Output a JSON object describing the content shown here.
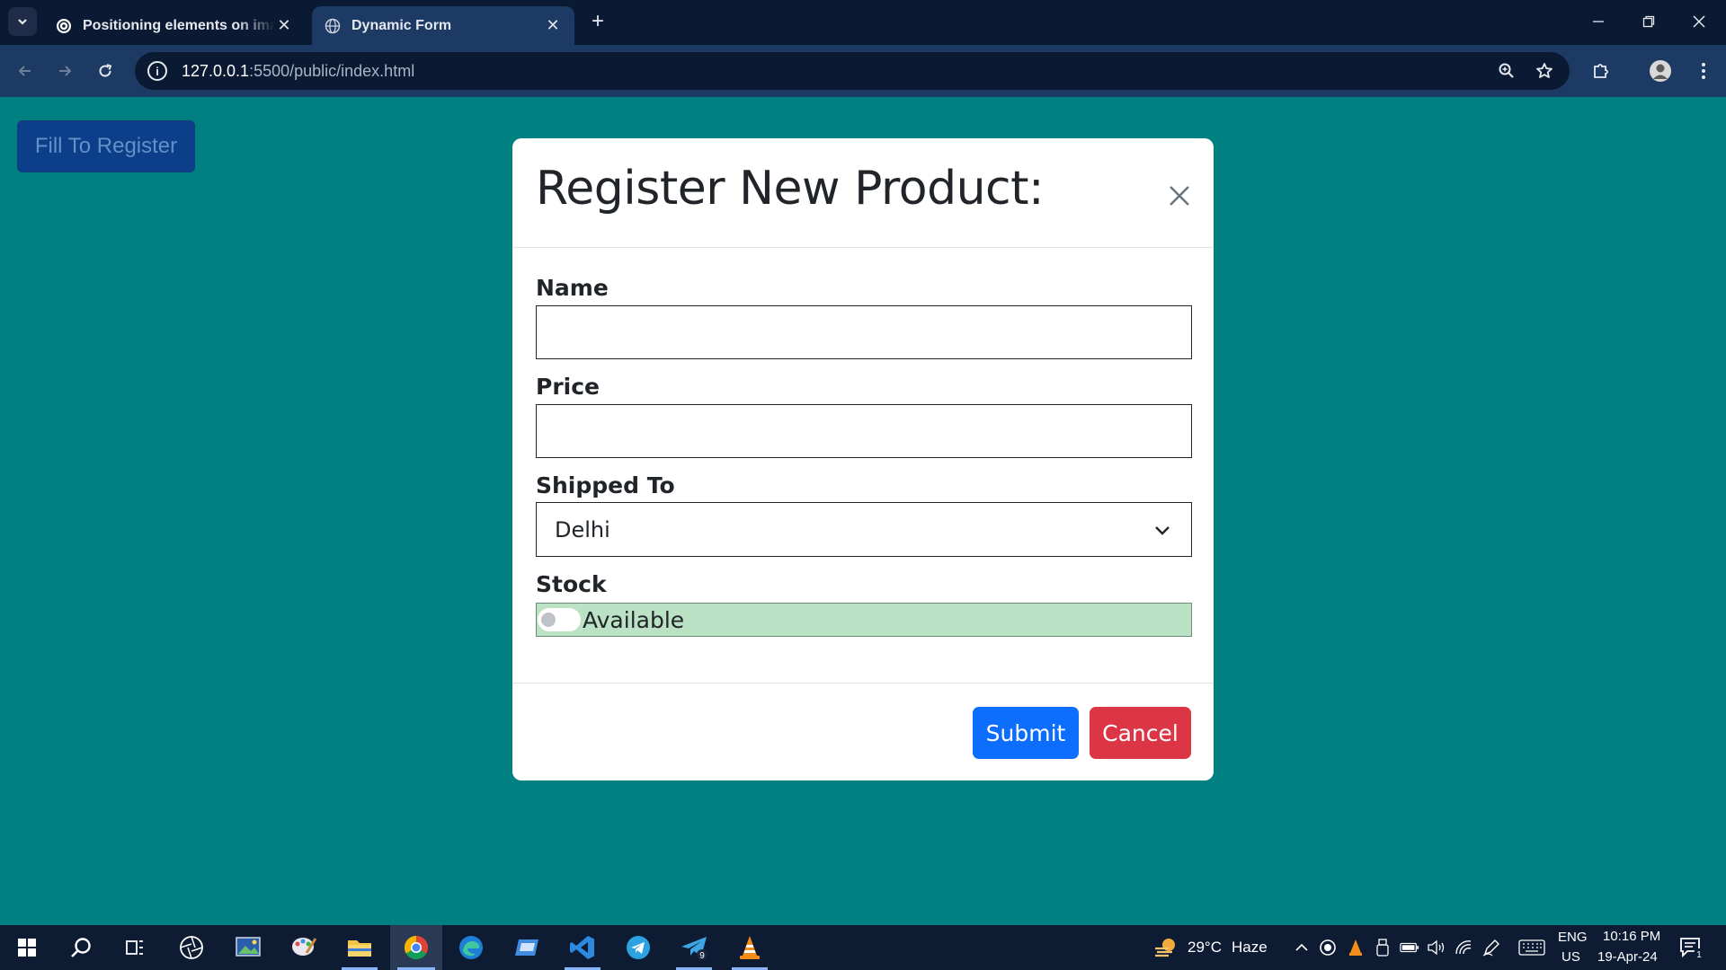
{
  "browser": {
    "tabs": [
      {
        "title": "Positioning elements on image",
        "active": false
      },
      {
        "title": "Dynamic Form",
        "active": true
      }
    ],
    "url_host": "127.0.0.1",
    "url_path": ":5500/public/index.html"
  },
  "page": {
    "fill_button_label": "Fill To Register",
    "modal": {
      "title": "Register New Product:",
      "fields": {
        "name_label": "Name",
        "name_value": "",
        "price_label": "Price",
        "price_value": "",
        "shipped_label": "Shipped To",
        "shipped_value": "Delhi",
        "stock_label": "Stock",
        "stock_text": "Available",
        "stock_on": false
      },
      "submit_label": "Submit",
      "cancel_label": "Cancel"
    }
  },
  "taskbar": {
    "weather_temp": "29°C",
    "weather_desc": "Haze",
    "lang_top": "ENG",
    "lang_bottom": "US",
    "time": "10:16 PM",
    "date": "19-Apr-24",
    "telegram_badge": "9",
    "notification_count": "1"
  },
  "colors": {
    "page_bg": "#008080",
    "submit": "#0d6efd",
    "cancel": "#dc3545",
    "stock_bg": "#bce2c5",
    "fill_button": "#0d3e8a"
  }
}
